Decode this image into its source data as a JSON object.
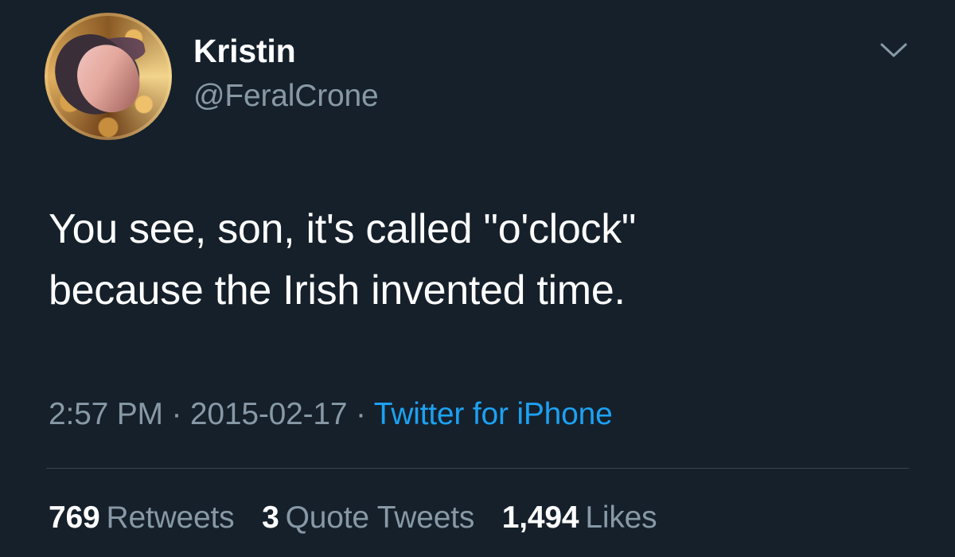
{
  "author": {
    "name": "Kristin",
    "handle": "@FeralCrone"
  },
  "tweet": {
    "text": "You see, son, it's called \"o'clock\"\nbecause the Irish invented time."
  },
  "metadata": {
    "time": "2:57 PM",
    "separator_1": " · ",
    "date": "2015-02-17",
    "separator_2": " · ",
    "source": "Twitter for iPhone"
  },
  "stats": {
    "retweets_count": "769",
    "retweets_label": "Retweets",
    "quote_tweets_count": "3",
    "quote_tweets_label": "Quote Tweets",
    "likes_count": "1,494",
    "likes_label": "Likes"
  },
  "icons": {
    "menu": "chevron-down-icon",
    "avatar": "avatar"
  },
  "colors": {
    "background": "#15202b",
    "primary_text": "#ffffff",
    "secondary_text": "#8899a6",
    "link": "#1da1f2",
    "divider": "#38444d"
  }
}
